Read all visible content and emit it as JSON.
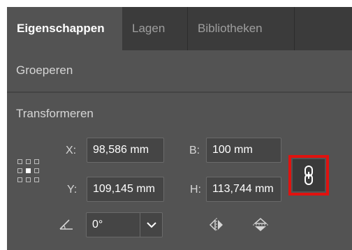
{
  "tabs": [
    {
      "label": "Eigenschappen",
      "active": true
    },
    {
      "label": "Lagen",
      "active": false
    },
    {
      "label": "Bibliotheken",
      "active": false
    }
  ],
  "sections": {
    "group": "Groeperen",
    "transform": "Transformeren"
  },
  "transform": {
    "x": {
      "label": "X:",
      "value": "98,586 mm"
    },
    "y": {
      "label": "Y:",
      "value": "109,145 mm"
    },
    "w": {
      "label": "B:",
      "value": "100 mm"
    },
    "h": {
      "label": "H:",
      "value": "113,744 mm"
    },
    "rotation": {
      "value": "0°"
    }
  },
  "icons": {
    "reference_point": "reference-point-grid-icon",
    "constrain": "chain-link-icon",
    "angle": "angle-icon",
    "flip_h": "flip-horizontal-icon",
    "flip_v": "flip-vertical-icon"
  },
  "colors": {
    "panel": "#535353",
    "tabbar": "#3b3b3b",
    "highlight": "#e0120f"
  }
}
